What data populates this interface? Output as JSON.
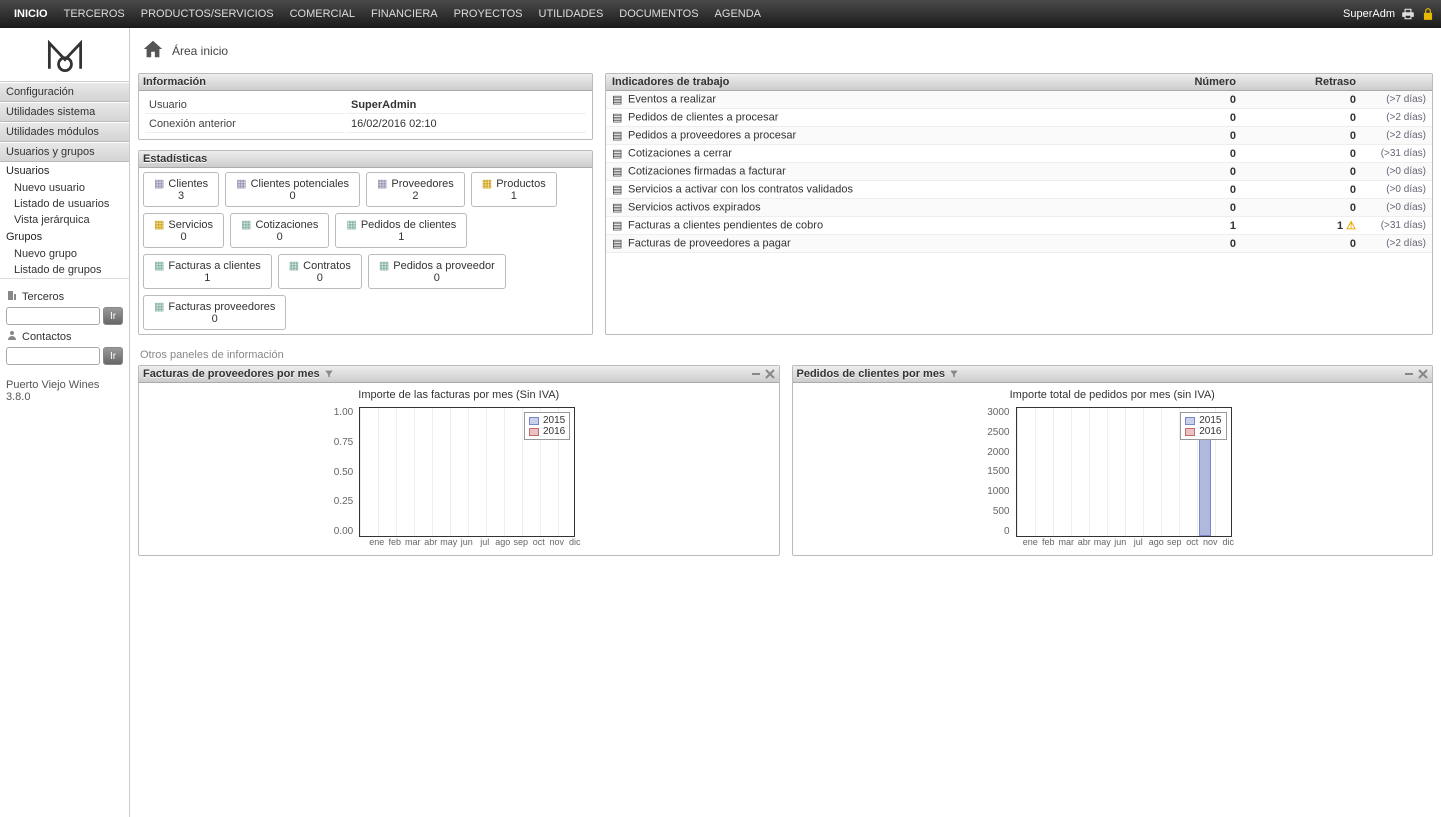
{
  "topnav": {
    "items": [
      "INICIO",
      "TERCEROS",
      "PRODUCTOS/SERVICIOS",
      "COMERCIAL",
      "FINANCIERA",
      "PROYECTOS",
      "UTILIDADES",
      "DOCUMENTOS",
      "AGENDA"
    ],
    "active_index": 0,
    "user_label": "SuperAdm"
  },
  "sidebar": {
    "sections": [
      {
        "label": "Configuración"
      },
      {
        "label": "Utilidades sistema"
      },
      {
        "label": "Utilidades módulos"
      },
      {
        "label": "Usuarios y grupos"
      }
    ],
    "users_head": "Usuarios",
    "users_links": [
      "Nuevo usuario",
      "Listado de usuarios",
      "Vista jerárquica"
    ],
    "groups_head": "Grupos",
    "groups_links": [
      "Nuevo grupo",
      "Listado de grupos"
    ],
    "search_terceros": "Terceros",
    "search_contactos": "Contactos",
    "go_btn": "Ir",
    "footer": "Puerto Viejo Wines 3.8.0"
  },
  "content": {
    "breadcrumb": "Área inicio",
    "info_panel": {
      "title": "Información",
      "rows": [
        {
          "label": "Usuario",
          "value": "SuperAdmin"
        },
        {
          "label": "Conexión anterior",
          "value": "16/02/2016 02:10"
        }
      ]
    },
    "stats_panel": {
      "title": "Estadísticas",
      "items": [
        {
          "label": "Clientes",
          "value": "3"
        },
        {
          "label": "Clientes potenciales",
          "value": "0"
        },
        {
          "label": "Proveedores",
          "value": "2"
        },
        {
          "label": "Productos",
          "value": "1"
        },
        {
          "label": "Servicios",
          "value": "0"
        },
        {
          "label": "Cotizaciones",
          "value": "0"
        },
        {
          "label": "Pedidos de clientes",
          "value": "1"
        },
        {
          "label": "Facturas a clientes",
          "value": "1"
        },
        {
          "label": "Contratos",
          "value": "0"
        },
        {
          "label": "Pedidos a proveedor",
          "value": "0"
        },
        {
          "label": "Facturas proveedores",
          "value": "0"
        }
      ]
    },
    "indicators_panel": {
      "title": "Indicadores de trabajo",
      "col_num": "Número",
      "col_delay": "Retraso",
      "rows": [
        {
          "label": "Eventos a realizar",
          "num": "0",
          "delay": "0",
          "info": "(>7 días)"
        },
        {
          "label": "Pedidos de clientes a procesar",
          "num": "0",
          "delay": "0",
          "info": "(>2 días)"
        },
        {
          "label": "Pedidos a proveedores a procesar",
          "num": "0",
          "delay": "0",
          "info": "(>2 días)"
        },
        {
          "label": "Cotizaciones a cerrar",
          "num": "0",
          "delay": "0",
          "info": "(>31 días)"
        },
        {
          "label": "Cotizaciones firmadas a facturar",
          "num": "0",
          "delay": "0",
          "info": "(>0 días)"
        },
        {
          "label": "Servicios a activar con los contratos validados",
          "num": "0",
          "delay": "0",
          "info": "(>0 días)"
        },
        {
          "label": "Servicios activos expirados",
          "num": "0",
          "delay": "0",
          "info": "(>0 días)"
        },
        {
          "label": "Facturas a clientes pendientes de cobro",
          "num": "1",
          "delay": "1",
          "info": "(>31 días)",
          "warn": true
        },
        {
          "label": "Facturas de proveedores a pagar",
          "num": "0",
          "delay": "0",
          "info": "(>2 días)"
        }
      ]
    },
    "other_title": "Otros paneles de información",
    "chart1": {
      "title": "Facturas de proveedores por mes",
      "caption": "Importe de las facturas por mes (Sin IVA)"
    },
    "chart2": {
      "title": "Pedidos de clientes por mes",
      "caption": "Importe total de pedidos por mes (sin IVA)"
    }
  },
  "chart_data": [
    {
      "type": "bar",
      "title": "Importe de las facturas por mes (Sin IVA)",
      "categories": [
        "ene",
        "feb",
        "mar",
        "abr",
        "may",
        "jun",
        "jul",
        "ago",
        "sep",
        "oct",
        "nov",
        "dic"
      ],
      "series": [
        {
          "name": "2015",
          "values": [
            0,
            0,
            0,
            0,
            0,
            0,
            0,
            0,
            0,
            0,
            0,
            0
          ],
          "color": "#7a8ac7"
        },
        {
          "name": "2016",
          "values": [
            0,
            0,
            0,
            0,
            0,
            0,
            0,
            0,
            0,
            0,
            0,
            0
          ],
          "color": "#c76a6a"
        }
      ],
      "ylim": [
        0,
        1.0
      ],
      "yticks": [
        0.0,
        0.25,
        0.5,
        0.75,
        1.0
      ],
      "xlabel": "",
      "ylabel": ""
    },
    {
      "type": "bar",
      "title": "Importe total de pedidos por mes (sin IVA)",
      "categories": [
        "ene",
        "feb",
        "mar",
        "abr",
        "may",
        "jun",
        "jul",
        "ago",
        "sep",
        "oct",
        "nov",
        "dic"
      ],
      "series": [
        {
          "name": "2015",
          "values": [
            0,
            0,
            0,
            0,
            0,
            0,
            0,
            0,
            0,
            0,
            2500,
            0
          ],
          "color": "#7a8ac7"
        },
        {
          "name": "2016",
          "values": [
            0,
            0,
            0,
            0,
            0,
            0,
            0,
            0,
            0,
            0,
            0,
            0
          ],
          "color": "#c76a6a"
        }
      ],
      "ylim": [
        0,
        3000
      ],
      "yticks": [
        0,
        500,
        1000,
        1500,
        2000,
        2500,
        3000
      ],
      "xlabel": "",
      "ylabel": ""
    }
  ]
}
